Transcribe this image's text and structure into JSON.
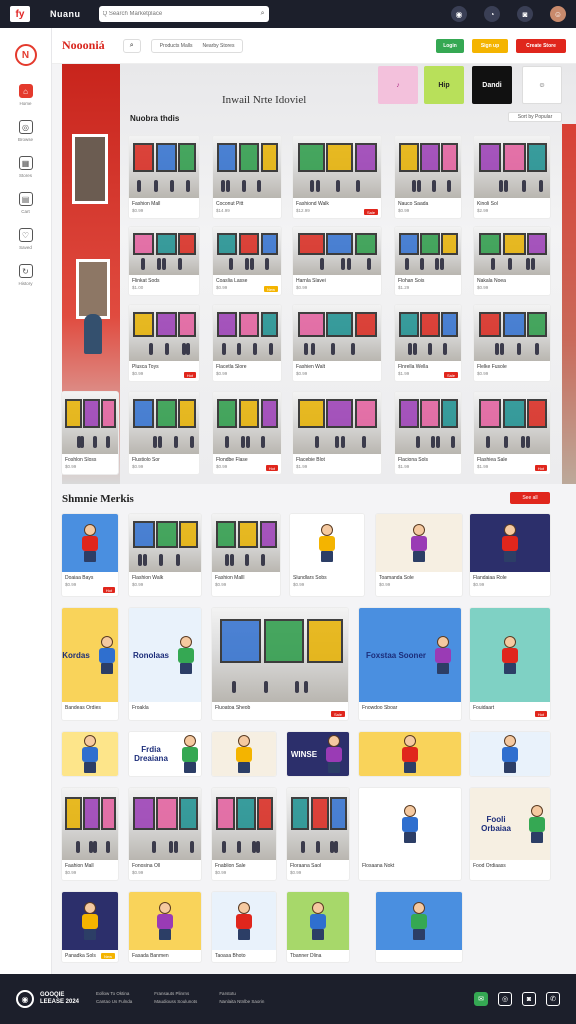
{
  "topbar": {
    "logo": "fy",
    "brand": "Nuanu",
    "search_placeholder": "Q Search Marketplace",
    "icons": [
      "notification-icon",
      "clock-icon",
      "camera-icon",
      "user-avatar"
    ]
  },
  "sidebar": {
    "logo": "N",
    "items": [
      {
        "icon": "store-icon",
        "label": "Home",
        "active": true
      },
      {
        "icon": "globe-icon",
        "label": "Browse"
      },
      {
        "icon": "grid-icon",
        "label": "Stores"
      },
      {
        "icon": "cart-icon",
        "label": "Cart"
      },
      {
        "icon": "heart-icon",
        "label": "Saved"
      },
      {
        "icon": "refresh-icon",
        "label": "History"
      }
    ]
  },
  "header": {
    "brand": "Noooniá",
    "tabs": [
      "Products Malls",
      "Nearby Stores"
    ],
    "buttons": [
      {
        "label": "Login",
        "color": "#35a853"
      },
      {
        "label": "Sign up",
        "color": "#f4b400"
      },
      {
        "label": "Create Store",
        "color": "#e0261c"
      }
    ]
  },
  "hero": {
    "title": "Inwail Nrte Idoviel",
    "subtitle": "Nuobra thdis",
    "filter": "Sort by Popular",
    "promos": [
      {
        "label": "♪",
        "bg": "#f3c1dc"
      },
      {
        "label": "Hip",
        "bg": "#b8e05a"
      },
      {
        "label": "Dandi",
        "bg": "#111111"
      },
      {
        "label": "☺",
        "bg": "#ffffff"
      }
    ]
  },
  "mall_grid": {
    "rows": [
      [
        {
          "name": "Fashion Mall",
          "price": "$0.99",
          "tag": ""
        },
        {
          "name": "Coconut Pitt",
          "price": "$14.99",
          "tag": ""
        },
        {
          "name": "Fashiond Walk",
          "price": "$12.99",
          "tag": "Sale"
        },
        {
          "name": "Nauco Saada",
          "price": "$0.99",
          "tag": ""
        },
        {
          "name": "Kinoli Sol",
          "price": "$2.99",
          "tag": ""
        }
      ],
      [
        {
          "name": "Flinkat Sods",
          "price": "$1.00",
          "tag": ""
        },
        {
          "name": "Coaslia Lasse",
          "price": "$0.99",
          "tag": "New"
        },
        {
          "name": "Harnla Slavei",
          "price": "$0.99",
          "tag": ""
        },
        {
          "name": "Flohan Sois",
          "price": "$1.29",
          "tag": ""
        },
        {
          "name": "Nakala Noea",
          "price": "$0.99",
          "tag": ""
        }
      ],
      [
        {
          "name": "Plusca Toys",
          "price": "$0.99",
          "tag": "Hot"
        },
        {
          "name": "Flacetla Slore",
          "price": "$0.99",
          "tag": ""
        },
        {
          "name": "Fashien Walt",
          "price": "$0.99",
          "tag": ""
        },
        {
          "name": "Flnrella Wella",
          "price": "$1.99",
          "tag": "Sale"
        },
        {
          "name": "Flelke Fusole",
          "price": "$0.99",
          "tag": ""
        }
      ],
      [
        {
          "name": "Flustiolo Sor",
          "price": "$0.99",
          "tag": ""
        },
        {
          "name": "Flondbe Flase",
          "price": "$0.99",
          "tag": "Hot"
        },
        {
          "name": "Flacebie Blot",
          "price": "$1.99",
          "tag": ""
        },
        {
          "name": "Flaciona Sols",
          "price": "$1.99",
          "tag": ""
        },
        {
          "name": "Flashiea Sale",
          "price": "$1.99",
          "tag": "Hot"
        }
      ]
    ],
    "hero_side_card": {
      "name": "Foshlon Sloss",
      "price": "$0.99"
    }
  },
  "section": {
    "title": "Shmnie Merkis",
    "button": "See all"
  },
  "shop_grid": {
    "row1": [
      {
        "name": "Doaiaa Bays",
        "price": "$0.99",
        "tag": "Hot",
        "kind": "cartoon"
      },
      {
        "name": "Flashion Walk",
        "price": "$0.99",
        "tag": "",
        "kind": "mall"
      },
      {
        "name": "Fashion Malll",
        "price": "$0.99",
        "tag": "",
        "kind": "mall"
      },
      {
        "name": "Slundlars Sobs",
        "price": "$0.99",
        "tag": "",
        "kind": "cartoon"
      },
      {
        "name": "Toamanda Sole",
        "price": "$0.99",
        "tag": "",
        "kind": "cartoon"
      },
      {
        "name": "Flandaiaa Role",
        "price": "$0.99",
        "tag": "",
        "kind": "cartoon"
      }
    ],
    "row2": [
      {
        "name": "Bandeas Ordies",
        "price": "",
        "tag": "",
        "kind": "cartoon",
        "text": "Kordas"
      },
      {
        "name": "Froakla",
        "price": "",
        "tag": "",
        "kind": "cartoon",
        "text": "Ronolaas"
      },
      {
        "name": "Fluoatoa Sheob",
        "price": "",
        "tag": "Sale",
        "kind": "mall"
      },
      {
        "name": "Fnowdoo Sboar",
        "price": "",
        "tag": "",
        "kind": "cartoon",
        "text": "Foxstaa Sooner"
      },
      {
        "name": "Fouidaart",
        "price": "",
        "tag": "Hot",
        "kind": "cartoon"
      }
    ],
    "row3": [
      {
        "name": "",
        "kind": "cartoon"
      },
      {
        "name": "",
        "kind": "cartoon",
        "text": "Frdia Dreaiana"
      },
      {
        "name": "",
        "kind": "cartoon"
      },
      {
        "name": "",
        "kind": "cartoon",
        "text": "WINSE"
      },
      {
        "name": "",
        "kind": "cartoon"
      },
      {
        "name": "",
        "kind": "cartoon"
      }
    ],
    "row4": [
      {
        "name": "Faahion Mall",
        "price": "$0.99",
        "tag": "",
        "kind": "mall"
      },
      {
        "name": "Fonosina Oll",
        "price": "$0.99",
        "tag": "",
        "kind": "mall"
      },
      {
        "name": "Fnablion Sale",
        "price": "$0.99",
        "tag": "",
        "kind": "mall"
      },
      {
        "name": "Floraana Saol",
        "price": "$0.99",
        "tag": "",
        "kind": "mall"
      },
      {
        "name": "Flosaana Nokt",
        "price": "",
        "tag": "",
        "kind": "cartoon"
      },
      {
        "name": "Food Ordiaass",
        "price": "",
        "tag": "",
        "kind": "cartoon",
        "text": "Fooli Orbaiaa"
      }
    ],
    "row5": [
      {
        "name": "Panadka Sols",
        "price": "",
        "tag": "New",
        "kind": "cartoon"
      },
      {
        "name": "Fasada Banmen",
        "price": "",
        "tag": "",
        "kind": "cartoon"
      },
      {
        "name": "Taoasa Bhoto",
        "price": "",
        "tag": "",
        "kind": "cartoon"
      },
      {
        "name": "Tbanner Dlina",
        "price": "",
        "tag": "",
        "kind": "cartoon"
      },
      {
        "name": "",
        "price": "",
        "tag": "",
        "kind": "cartoon"
      }
    ]
  },
  "footer": {
    "brand_line1": "GOOQIE",
    "brand_line2": "LEEASE 2024",
    "columns": [
      [
        "Eollow To Oktina",
        "Cantao Us Fulnda"
      ],
      [
        "Fransauts Plinrns",
        "Maudiouss Soulunots"
      ],
      [
        "Farstotu",
        "Nanlaita Ntnlbe Saorin"
      ]
    ],
    "icons": [
      "chat-icon",
      "globe-icon",
      "camera-icon",
      "mail-icon"
    ]
  },
  "colors": {
    "accent": "#e0261c",
    "green": "#35a853",
    "yellow": "#f4b400",
    "dark": "#1c1f2b"
  }
}
